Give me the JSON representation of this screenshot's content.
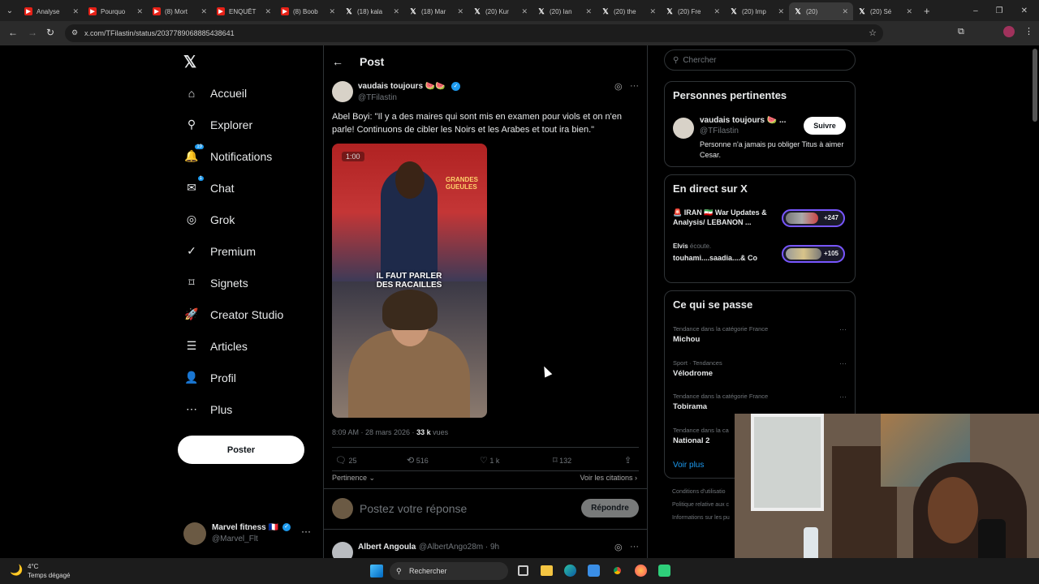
{
  "browser": {
    "tabs": [
      {
        "icon": "youtube",
        "title": "Analyse"
      },
      {
        "icon": "youtube",
        "title": "Pourquo"
      },
      {
        "icon": "youtube",
        "title": "(8) Mort"
      },
      {
        "icon": "youtube",
        "title": "ENQUÊT"
      },
      {
        "icon": "youtube",
        "title": "(8) Boob"
      },
      {
        "icon": "x",
        "title": "(18) kala"
      },
      {
        "icon": "x",
        "title": "(18) Mar"
      },
      {
        "icon": "x",
        "title": "(20) Kur"
      },
      {
        "icon": "x",
        "title": "(20) Ian"
      },
      {
        "icon": "x",
        "title": "(20) the"
      },
      {
        "icon": "x",
        "title": "(20) Fre"
      },
      {
        "icon": "x",
        "title": "(20) Imp"
      },
      {
        "icon": "x",
        "title": "(20)"
      },
      {
        "icon": "x",
        "title": "(20) Sé"
      }
    ],
    "url": "x.com/TFilastin/status/2037789068885438641"
  },
  "nav": {
    "items": [
      {
        "label": "Accueil",
        "icon": "home-icon"
      },
      {
        "label": "Explorer",
        "icon": "search-icon"
      },
      {
        "label": "Notifications",
        "icon": "bell-icon",
        "badge": "19"
      },
      {
        "label": "Chat",
        "icon": "mail-icon",
        "badge": "1"
      },
      {
        "label": "Grok",
        "icon": "grok-icon"
      },
      {
        "label": "Premium",
        "icon": "verified-icon"
      },
      {
        "label": "Signets",
        "icon": "bookmark-icon"
      },
      {
        "label": "Creator Studio",
        "icon": "rocket-icon"
      },
      {
        "label": "Articles",
        "icon": "article-icon"
      },
      {
        "label": "Profil",
        "icon": "person-icon"
      },
      {
        "label": "Plus",
        "icon": "more-circle-icon"
      }
    ],
    "post_button": "Poster",
    "me": {
      "name": "Marvel fitness 🇫🇷",
      "handle": "@Marvel_Flt"
    }
  },
  "post": {
    "header_title": "Post",
    "author_name": "vaudais toujours 🍉🍉",
    "author_handle": "@TFilastin",
    "text": "Abel Boyi: \"Il y a des maires qui sont mis en examen pour viols et on n'en parle! Continuons de cibler les Noirs et les Arabes et tout ira bien.\"",
    "video_time": "1:00",
    "video_caption": "IL FAUT PARLER DES RACAILLES",
    "video_logo": "GRANDES GUEULES",
    "meta_time": "8:09 AM · 28 mars 2026 · ",
    "views_count": "33 k",
    "views_label": " vues",
    "stats": {
      "replies": "25",
      "reposts": "516",
      "likes": "1 k",
      "bookmarks": "132"
    },
    "sort_label": "Pertinence",
    "quotes_label": "Voir les citations",
    "reply_placeholder": "Postez votre réponse",
    "reply_button": "Répondre",
    "next_reply": {
      "name": "Albert Angoula",
      "handle": "@AlbertAngo28m · 9h"
    }
  },
  "sidebar": {
    "search_placeholder": "Chercher",
    "relevant": {
      "title": "Personnes pertinentes",
      "name": "vaudais toujours 🍉 ...",
      "handle": "@TFilastin",
      "follow": "Suivre",
      "bio": "Personne n'a jamais pu obliger Titus à aimer Cesar."
    },
    "live": {
      "title": "En direct sur X",
      "items": [
        {
          "title": "🚨 IRAN 🇮🇷 War Updates & Analysis/ LEBANON ...",
          "count": "+247"
        },
        {
          "host": "Elvis",
          "host_suffix": " écoute.",
          "title": "touhami....saadia....& Co",
          "count": "+105"
        }
      ]
    },
    "trends": {
      "title": "Ce qui se passe",
      "items": [
        {
          "meta": "Tendance dans la catégorie France",
          "name": "Michou"
        },
        {
          "meta": "Sport · Tendances",
          "name": "Vélodrome"
        },
        {
          "meta": "Tendance dans la catégorie France",
          "name": "Tobirama"
        },
        {
          "meta": "Tendance dans la ca",
          "name": "National 2"
        }
      ],
      "more": "Voir plus"
    },
    "footer": [
      "Conditions d'utilisatio",
      "Politique relative aux c",
      "Informations sur les pu"
    ]
  },
  "taskbar": {
    "weather_temp": "4°C",
    "weather_desc": "Temps dégagé",
    "search_label": "Rechercher"
  },
  "colors": {
    "accent": "#1d9bf0",
    "background": "#000000",
    "border": "#2f3336",
    "muted": "#71767b"
  }
}
